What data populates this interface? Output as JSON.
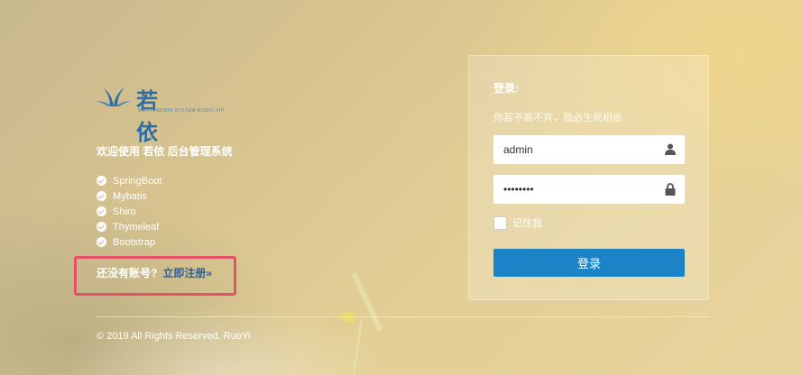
{
  "brand": {
    "name": "若 依",
    "subtitle": "RUOYI ADMIN SYSTEM  RUOYI.VIP"
  },
  "welcome": "欢迎使用 若依 后台管理系统",
  "tech_stack": [
    "SpringBoot",
    "Mybatis",
    "Shiro",
    "Thymeleaf",
    "Bootstrap"
  ],
  "register": {
    "prompt": "还没有账号?",
    "link": "立即注册»"
  },
  "copyright": "© 2019 All Rights Reserved. RuoYi",
  "login": {
    "title": "登录:",
    "tagline": "你若不离不弃，我必生死相依",
    "username_value": "admin",
    "password_value": "••••••••",
    "remember_label": "记住我",
    "submit_label": "登录"
  },
  "colors": {
    "accent": "#1c84c6",
    "brand": "#2d6ea8",
    "highlight_box": "#e8506a"
  }
}
